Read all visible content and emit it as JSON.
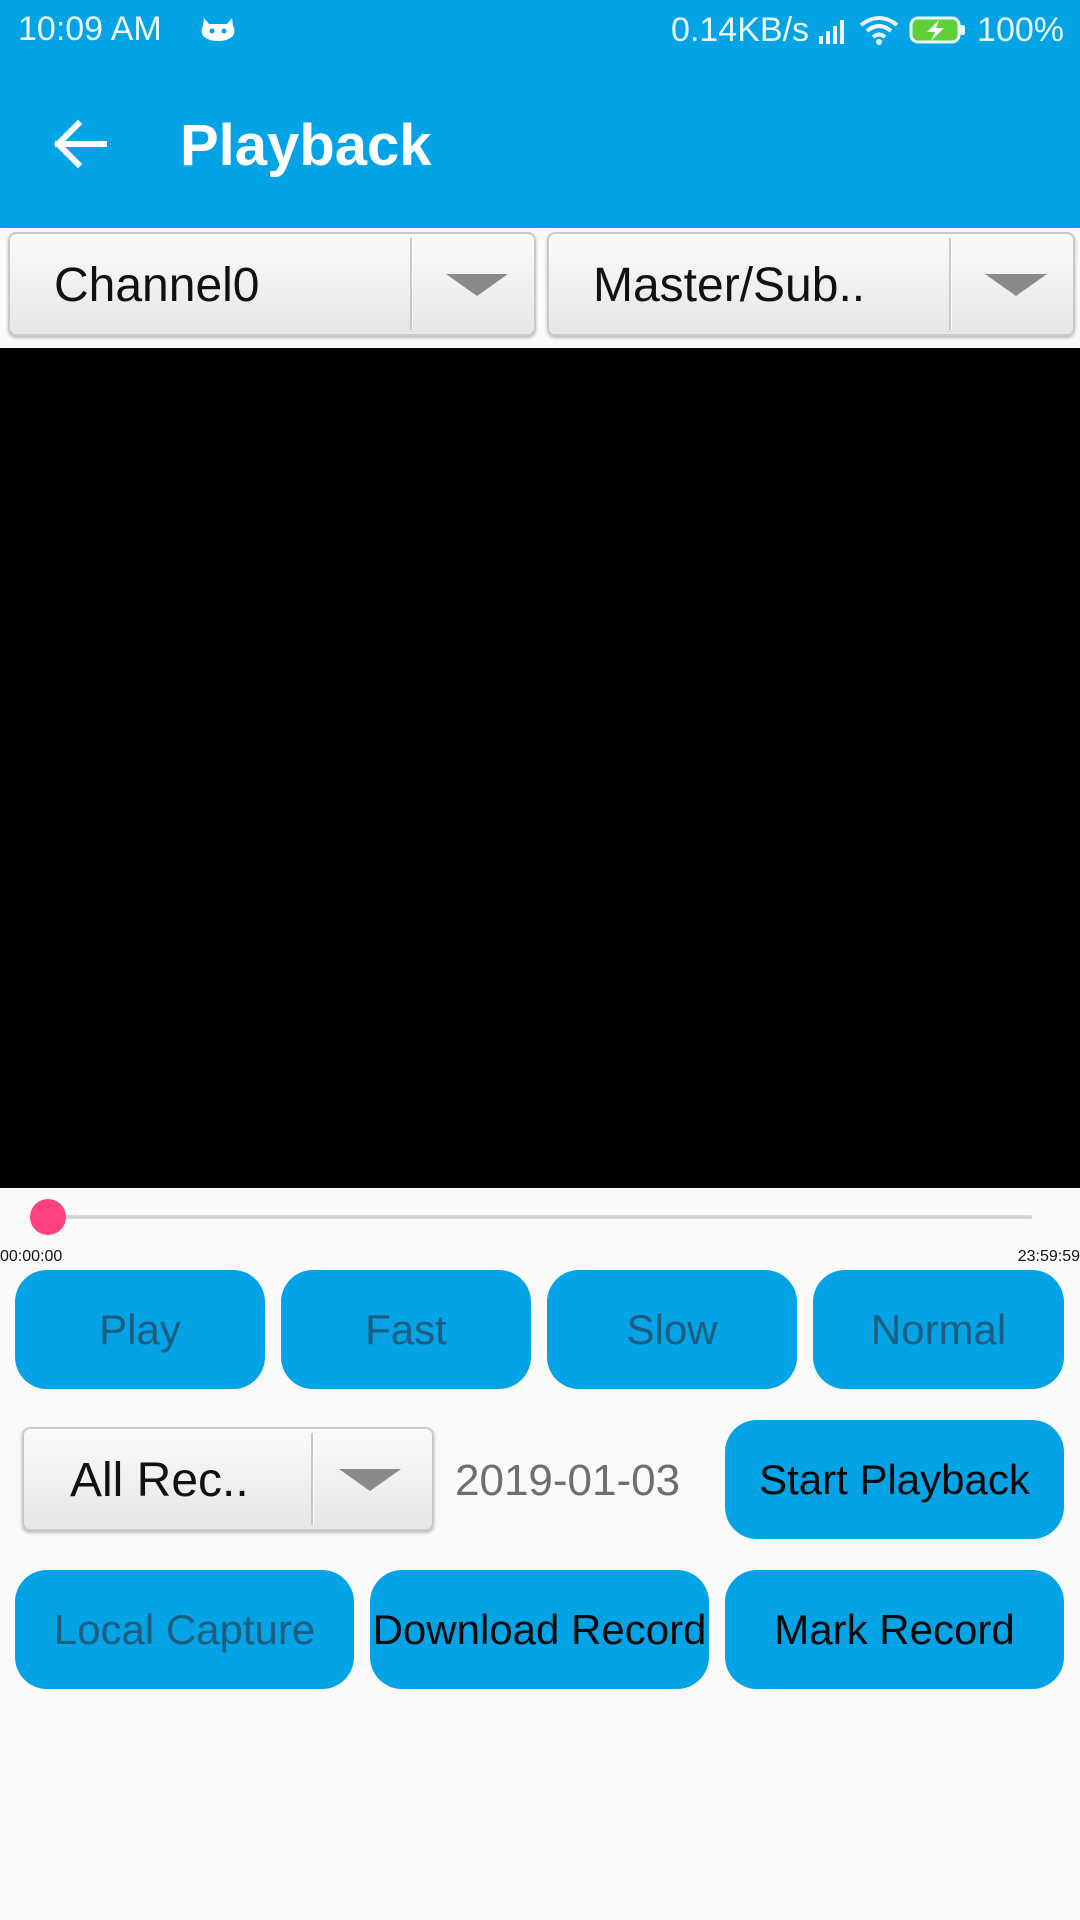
{
  "status_bar": {
    "time": "10:09  AM",
    "net_speed": "0.14KB/s",
    "battery": "100%",
    "icons": [
      "android-cat-icon",
      "signal-icon",
      "wifi-icon",
      "battery-charging-icon"
    ]
  },
  "app_bar": {
    "title": "Playback",
    "back_icon": "arrow-back-icon",
    "color": "#03a3e5"
  },
  "spinners": {
    "channel": "Channel0",
    "stream": "Master/Sub..",
    "record_type": "All Rec.."
  },
  "seek_bar": {
    "start_time": "00:00:00",
    "end_time": "23:59:59",
    "progress": 0,
    "thumb_color": "#ff4081"
  },
  "speed_buttons": {
    "play": "Play",
    "fast": "Fast",
    "slow": "Slow",
    "normal": "Normal"
  },
  "playback": {
    "date": "2019-01-03",
    "start_label": "Start Playback"
  },
  "record_buttons": {
    "local_capture": "Local Capture",
    "download": "Download Record",
    "mark": "Mark Record"
  }
}
